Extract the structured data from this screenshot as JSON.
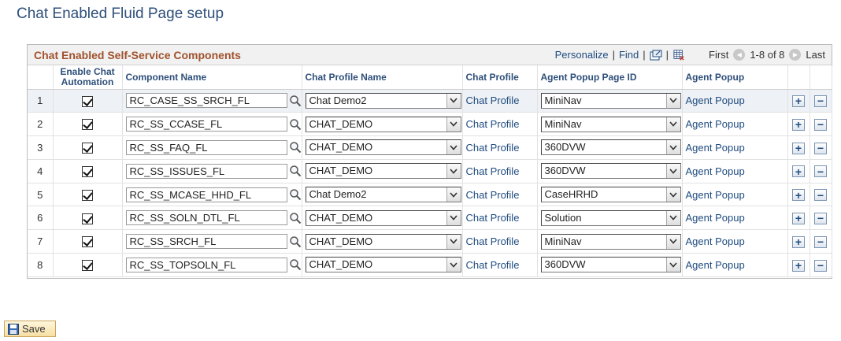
{
  "page": {
    "title": "Chat Enabled Fluid Page setup"
  },
  "grid": {
    "title": "Chat Enabled Self-Service Components",
    "nav": {
      "personalize": "Personalize",
      "find": "Find",
      "first": "First",
      "range": "1-8 of 8",
      "last": "Last"
    },
    "columns": {
      "enable_chat_line1": "Enable Chat",
      "enable_chat_line2": "Automation",
      "component_name": "Component Name",
      "chat_profile_name": "Chat Profile Name",
      "chat_profile": "Chat Profile",
      "agent_popup_page_id": "Agent Popup Page ID",
      "agent_popup": "Agent Popup"
    },
    "rows": [
      {
        "num": "1",
        "checked": true,
        "component": "RC_CASE_SS_SRCH_FL",
        "profile_name": "Chat Demo2",
        "chat_profile": "Chat Profile",
        "page_id": "MiniNav",
        "agent_popup": "Agent Popup"
      },
      {
        "num": "2",
        "checked": true,
        "component": "RC_SS_CCASE_FL",
        "profile_name": "CHAT_DEMO",
        "chat_profile": "Chat Profile",
        "page_id": "MiniNav",
        "agent_popup": "Agent Popup"
      },
      {
        "num": "3",
        "checked": true,
        "component": "RC_SS_FAQ_FL",
        "profile_name": "CHAT_DEMO",
        "chat_profile": "Chat Profile",
        "page_id": "360DVW",
        "agent_popup": "Agent Popup"
      },
      {
        "num": "4",
        "checked": true,
        "component": "RC_SS_ISSUES_FL",
        "profile_name": "CHAT_DEMO",
        "chat_profile": "Chat Profile",
        "page_id": "360DVW",
        "agent_popup": "Agent Popup"
      },
      {
        "num": "5",
        "checked": true,
        "component": "RC_SS_MCASE_HHD_FL",
        "profile_name": "Chat Demo2",
        "chat_profile": "Chat Profile",
        "page_id": "CaseHRHD",
        "agent_popup": "Agent Popup"
      },
      {
        "num": "6",
        "checked": true,
        "component": "RC_SS_SOLN_DTL_FL",
        "profile_name": "CHAT_DEMO",
        "chat_profile": "Chat Profile",
        "page_id": "Solution",
        "agent_popup": "Agent Popup"
      },
      {
        "num": "7",
        "checked": true,
        "component": "RC_SS_SRCH_FL",
        "profile_name": "CHAT_DEMO",
        "chat_profile": "Chat Profile",
        "page_id": "MiniNav",
        "agent_popup": "Agent Popup"
      },
      {
        "num": "8",
        "checked": true,
        "component": "RC_SS_TOPSOLN_FL",
        "profile_name": "CHAT_DEMO",
        "chat_profile": "Chat Profile",
        "page_id": "360DVW",
        "agent_popup": "Agent Popup"
      }
    ],
    "add_symbol": "+",
    "remove_symbol": "−"
  },
  "footer": {
    "save_label": "Save"
  },
  "icons": {
    "lookup": "magnifier-icon",
    "dropdown": "chevron-down-icon",
    "save": "floppy-disk-icon",
    "zoom": "new-window-icon",
    "download": "spreadsheet-download-icon"
  },
  "colors": {
    "title": "#2e4f7a",
    "grid_title": "#a0522d",
    "link": "#1f4c80",
    "save_bg": "#f6dfa2"
  }
}
